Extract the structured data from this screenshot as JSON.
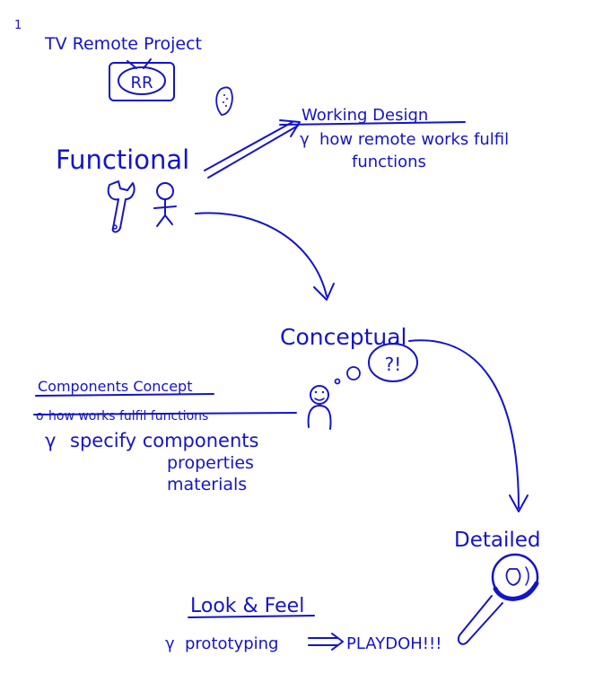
{
  "page_number": "1",
  "title": "TV Remote Project",
  "tv_label": "RR",
  "stages": {
    "functional": {
      "label": "Functional",
      "note_title": "Working Design",
      "note_lines": [
        "how remote works fulfil",
        "functions"
      ]
    },
    "conceptual": {
      "label": "Conceptual",
      "thought_text": "?!",
      "note_title": "Components Concept",
      "struck_line": "how works fulfil functions",
      "note_lines": [
        "specify components",
        "properties",
        "materials"
      ]
    },
    "detailed": {
      "label": "Detailed",
      "note_title": "Look & Feel",
      "note_line": "prototyping",
      "arrow_target": "PLAYDOH!!!"
    }
  },
  "colors": {
    "ink": "#1414c8",
    "background": "#ffffff"
  }
}
